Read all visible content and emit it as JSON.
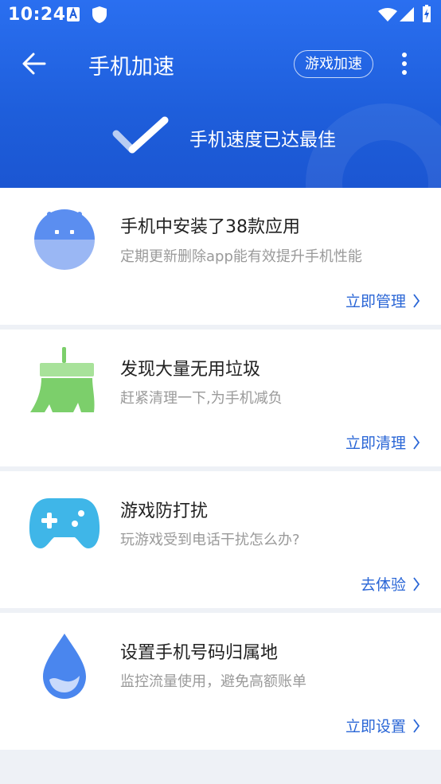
{
  "status_bar": {
    "time": "10:24"
  },
  "toolbar": {
    "title": "手机加速",
    "game_chip": "游戏加速"
  },
  "hero": {
    "status_text": "手机速度已达最佳"
  },
  "cards": [
    {
      "title": "手机中安装了38款应用",
      "desc": "定期更新删除app能有效提升手机性能",
      "action": "立即管理",
      "icon": "android-icon"
    },
    {
      "title": "发现大量无用垃圾",
      "desc": "赶紧清理一下,为手机减负",
      "action": "立即清理",
      "icon": "broom-icon"
    },
    {
      "title": "游戏防打扰",
      "desc": "玩游戏受到电话干扰怎么办?",
      "action": "去体验",
      "icon": "gamepad-icon"
    },
    {
      "title": "设置手机号码归属地",
      "desc": "监控流量使用，避免高额账单",
      "action": "立即设置",
      "icon": "water-drop-icon"
    }
  ],
  "colors": {
    "header_blue": "#1e5edb",
    "accent_link": "#2a66d6",
    "android": "#5b8ef0",
    "broom": "#7ccf6b",
    "gamepad": "#3fb6e8",
    "drop": "#4a86ee"
  }
}
